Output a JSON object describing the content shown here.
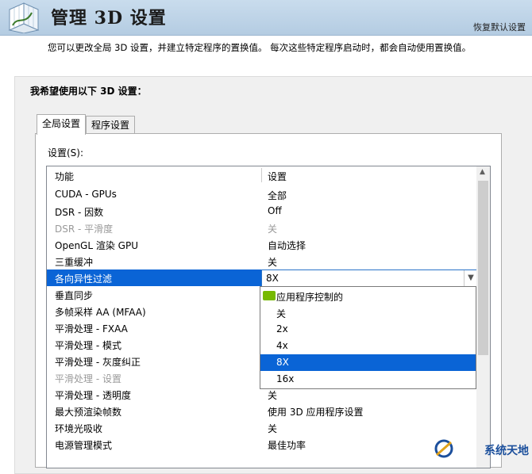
{
  "header": {
    "title": "管理 3D 设置",
    "restore": "恢复默认设置"
  },
  "description": "您可以更改全局 3D 设置，并建立特定程序的置换值。 每次这些特定程序启动时，都会自动使用置换值。",
  "panel": {
    "title": "我希望使用以下 3D 设置："
  },
  "tabs": [
    {
      "label": "全局设置",
      "active": true
    },
    {
      "label": "程序设置",
      "active": false
    }
  ],
  "settings_label": "设置(S):",
  "grid": {
    "col_function": "功能",
    "col_setting": "设置",
    "rows": [
      {
        "f": "CUDA - GPUs",
        "v": "全部"
      },
      {
        "f": "DSR - 因数",
        "v": "Off"
      },
      {
        "f": "DSR - 平滑度",
        "v": "关",
        "disabled": true
      },
      {
        "f": "OpenGL 渲染 GPU",
        "v": "自动选择"
      },
      {
        "f": "三重缓冲",
        "v": "关"
      },
      {
        "f": "各向异性过滤",
        "v": "8X",
        "selected": true
      },
      {
        "f": "垂直同步",
        "v": ""
      },
      {
        "f": "多帧采样 AA (MFAA)",
        "v": ""
      },
      {
        "f": "平滑处理 - FXAA",
        "v": ""
      },
      {
        "f": "平滑处理 - 模式",
        "v": ""
      },
      {
        "f": "平滑处理 - 灰度纠正",
        "v": ""
      },
      {
        "f": "平滑处理 - 设置",
        "v": "",
        "disabled": true
      },
      {
        "f": "平滑处理 - 透明度",
        "v": "关"
      },
      {
        "f": "最大预渲染帧数",
        "v": "使用 3D 应用程序设置"
      },
      {
        "f": "环境光吸收",
        "v": "关"
      },
      {
        "f": "电源管理模式",
        "v": "最佳功率"
      }
    ]
  },
  "dropdown": {
    "options": [
      "应用程序控制的",
      "关",
      "2x",
      "4x",
      "8X",
      "16x"
    ],
    "highlighted": "8X"
  },
  "colors": {
    "selection": "#0a64d6",
    "nvidia": "#76b900",
    "header": "#c3d7ea"
  },
  "watermark": "系统天地"
}
